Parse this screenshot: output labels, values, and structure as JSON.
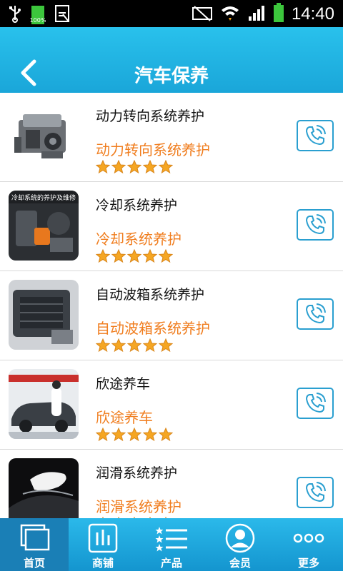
{
  "status_bar": {
    "battery_small_text": "100%",
    "time": "14:40"
  },
  "header": {
    "title": "汽车保养"
  },
  "items": [
    {
      "name": "动力转向系统养护",
      "subtitle": "动力转向系统养护",
      "rating": 5
    },
    {
      "name": "冷却系统养护",
      "subtitle": "冷却系统养护",
      "rating": 5,
      "thumb_caption": "冷却系统的养护及维修"
    },
    {
      "name": "自动波箱系统养护",
      "subtitle": "自动波箱系统养护",
      "rating": 5
    },
    {
      "name": "欣途养车",
      "subtitle": "欣途养车",
      "rating": 5
    },
    {
      "name": "润滑系统养护",
      "subtitle": "润滑系统养护",
      "rating": 5
    }
  ],
  "tabs": [
    {
      "label": "首页",
      "active": true
    },
    {
      "label": "商铺",
      "active": false
    },
    {
      "label": "产品",
      "active": false
    },
    {
      "label": "会员",
      "active": false
    },
    {
      "label": "更多",
      "active": false
    }
  ],
  "colors": {
    "accent": "#1aa6d9",
    "subtitle": "#f07d1e",
    "star": "#f5a623"
  }
}
